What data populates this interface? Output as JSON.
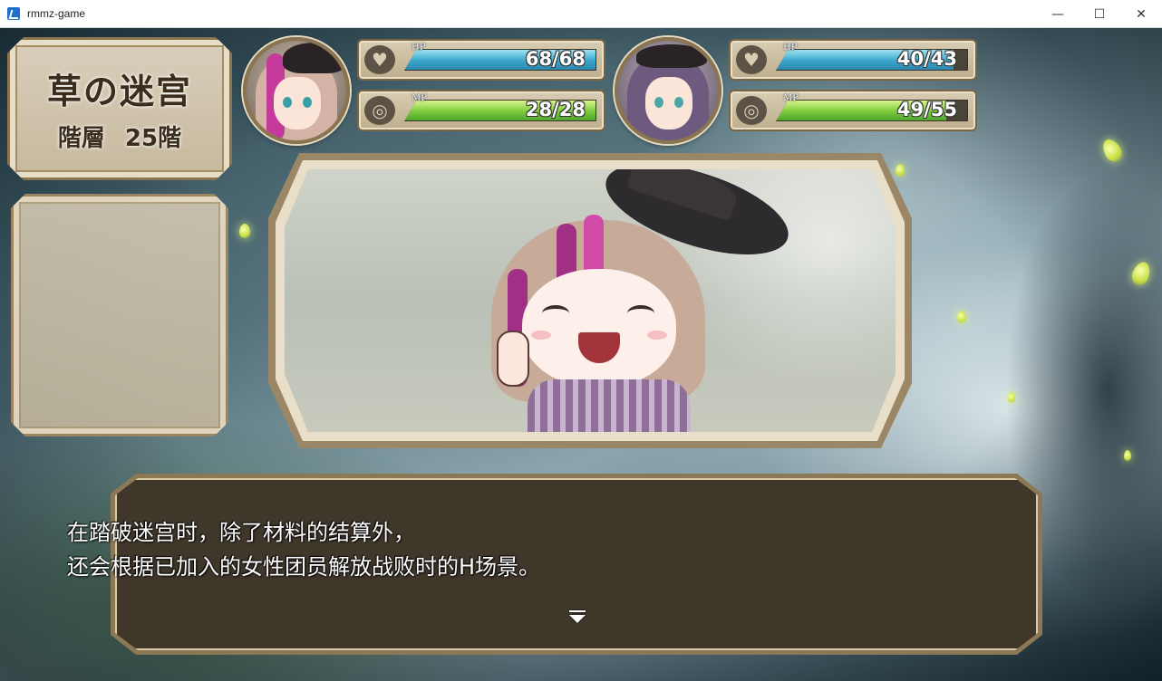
{
  "window": {
    "title": "rmmz-game",
    "controls": {
      "minimize": "—",
      "maximize": "☐",
      "close": "✕"
    }
  },
  "location": {
    "name": "草の迷宫",
    "floor_label": "階層",
    "floor_value": "25階"
  },
  "party": [
    {
      "hp": {
        "label": "HP",
        "value": "68/68",
        "current": 68,
        "max": 68
      },
      "mp": {
        "label": "MP",
        "value": "28/28",
        "current": 28,
        "max": 28
      },
      "colors": {
        "hair": "#d4b3a6",
        "accent": "#c43a9a",
        "hat": "#2a2326"
      }
    },
    {
      "hp": {
        "label": "HP",
        "value": "40/43",
        "current": 40,
        "max": 43
      },
      "mp": {
        "label": "MP",
        "value": "49/55",
        "current": 49,
        "max": 55
      },
      "colors": {
        "hair": "#6e5a7e",
        "accent": "#8a5fa8",
        "hat": "#2a2326"
      }
    }
  ],
  "icons": {
    "hp": "heart-icon",
    "mp": "spiral-icon"
  },
  "message": {
    "lines": [
      "在踏破迷宫时，除了材料的结算外，",
      "还会根据已加入的女性团员解放战败时的H场景。"
    ]
  },
  "colors": {
    "frame": "#8c7855",
    "panel": "#d9cfbb",
    "hp_fill": "#3aa6cc",
    "mp_fill": "#7ccb3c"
  }
}
